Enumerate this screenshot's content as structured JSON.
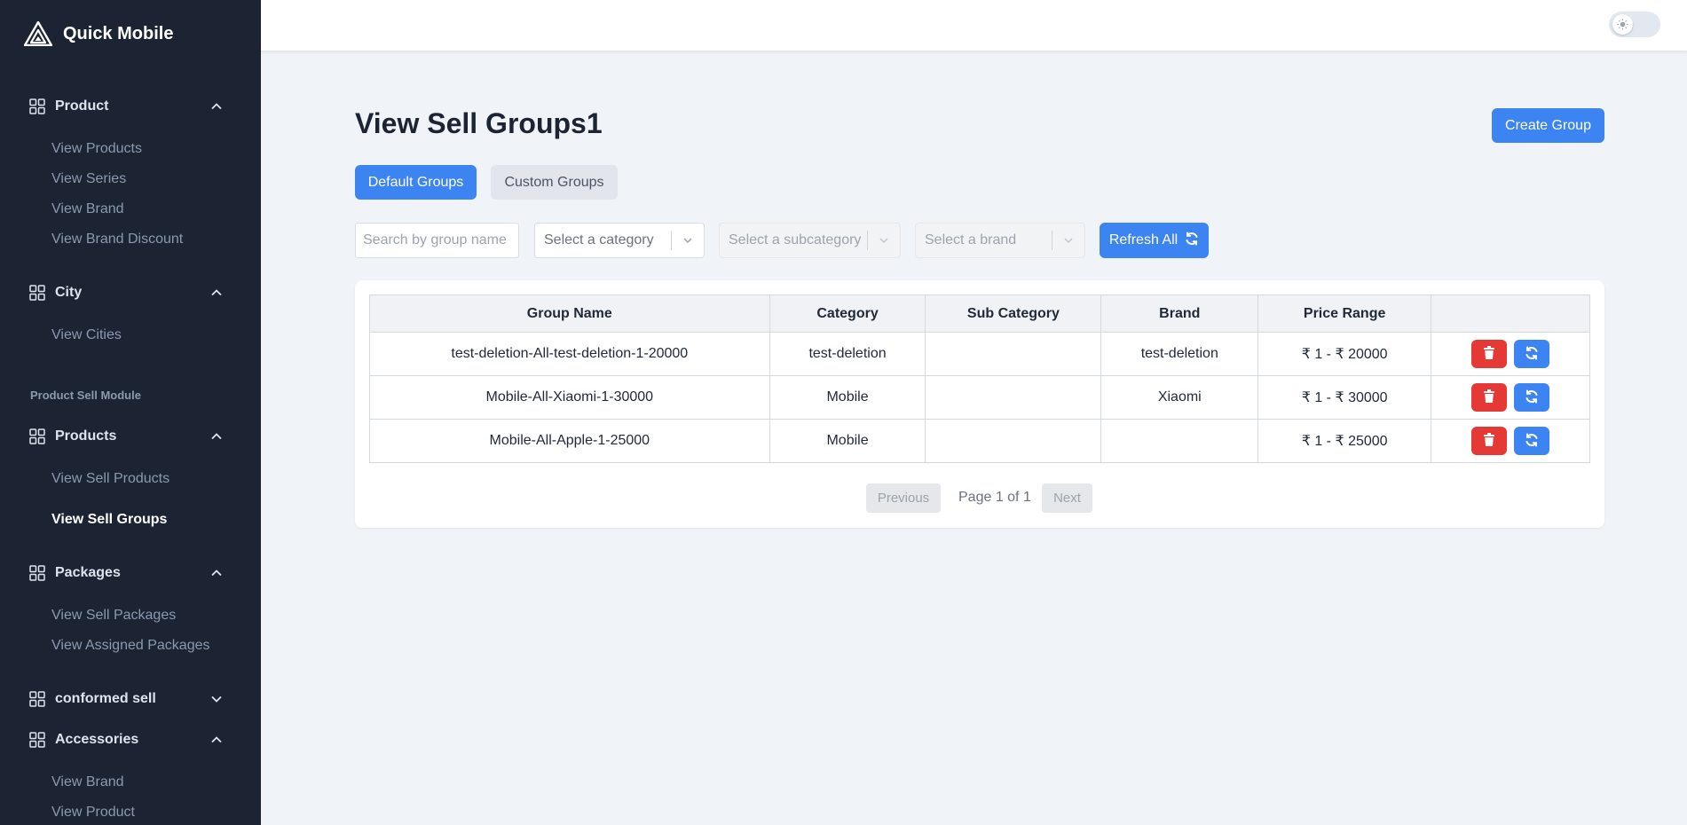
{
  "app": {
    "name": "Quick Mobile"
  },
  "sidebar": {
    "product": {
      "label": "Product",
      "items": [
        "View Products",
        "View Series",
        "View Brand",
        "View Brand Discount"
      ]
    },
    "city": {
      "label": "City",
      "items": [
        "View Cities"
      ]
    },
    "module_title": "Product Sell Module",
    "products": {
      "label": "Products",
      "items": [
        "View Sell Products",
        "View Sell Groups"
      ],
      "active": "View Sell Groups"
    },
    "packages": {
      "label": "Packages",
      "items": [
        "View Sell Packages",
        "View Assigned Packages"
      ]
    },
    "conformed_sell": {
      "label": "conformed sell"
    },
    "accessories": {
      "label": "Accessories",
      "items": [
        "View Brand",
        "View Product"
      ]
    }
  },
  "header": {
    "theme_toggle": "light"
  },
  "main": {
    "title": "View Sell Groups1",
    "create_button": "Create Group",
    "tabs": [
      "Default Groups",
      "Custom Groups"
    ],
    "active_tab": "Default Groups",
    "filters": {
      "search_placeholder": "Search by group name",
      "category_placeholder": "Select a category",
      "subcategory_placeholder": "Select a subcategory",
      "brand_placeholder": "Select a brand",
      "refresh_label": "Refresh All"
    },
    "table": {
      "columns": [
        "Group Name",
        "Category",
        "Sub Category",
        "Brand",
        "Price Range",
        ""
      ],
      "rows": [
        {
          "group_name": "test-deletion-All-test-deletion-1-20000",
          "category": "test-deletion",
          "sub_category": "",
          "brand": "test-deletion",
          "price_range": "₹ 1 - ₹ 20000"
        },
        {
          "group_name": "Mobile-All-Xiaomi-1-30000",
          "category": "Mobile",
          "sub_category": "",
          "brand": "Xiaomi",
          "price_range": "₹ 1 - ₹ 30000"
        },
        {
          "group_name": "Mobile-All-Apple-1-25000",
          "category": "Mobile",
          "sub_category": "",
          "brand": "",
          "price_range": "₹ 1 - ₹ 25000"
        }
      ]
    },
    "pagination": {
      "previous": "Previous",
      "info": "Page 1 of 1",
      "next": "Next"
    }
  },
  "colors": {
    "sidebar_bg": "#1c2434",
    "primary": "#3c84f2",
    "danger": "#e53935",
    "page_bg": "#f0f3f8"
  }
}
